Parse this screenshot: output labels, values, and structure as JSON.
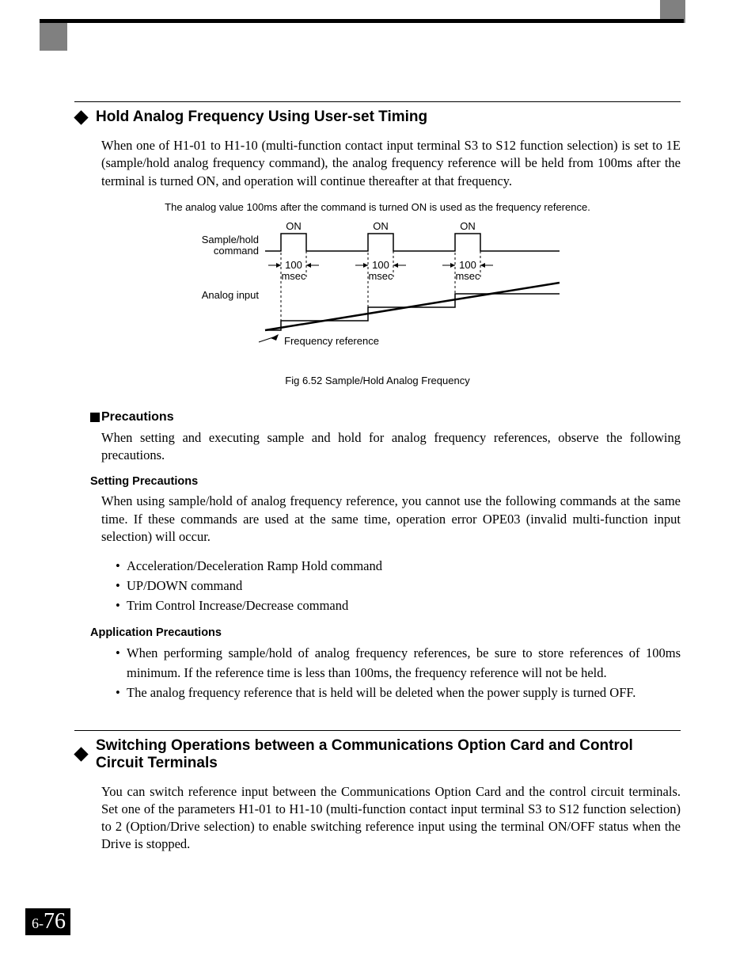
{
  "section1": {
    "title": "Hold Analog Frequency Using User-set Timing",
    "para1": "When one of H1-01 to H1-10 (multi-function contact input terminal S3 to S12 function selection) is set to 1E (sample/hold analog frequency command), the analog frequency reference will be held from 100ms after the terminal is turned ON, and operation will continue thereafter at that frequency.",
    "figure_note": "The analog value 100ms after the command is turned ON is used as the frequency reference.",
    "figure": {
      "labels": {
        "on1": "ON",
        "on2": "ON",
        "on3": "ON",
        "sample_hold_line1": "Sample/hold",
        "sample_hold_line2": "command",
        "ms1_top": "100",
        "ms1_bot": "msec",
        "ms2_top": "100",
        "ms2_bot": "msec",
        "ms3_top": "100",
        "ms3_bot": "msec",
        "analog_input": "Analog input",
        "freq_ref": "Frequency reference"
      }
    },
    "figure_caption": "Fig 6.52  Sample/Hold Analog Frequency",
    "precautions": {
      "title": "Precautions",
      "para": "When setting and executing sample and hold for analog frequency references, observe the following precautions.",
      "setting": {
        "title": "Setting Precautions",
        "para": "When using sample/hold of analog frequency reference, you cannot use the following commands at the same time. If these commands are used at the same time, operation error OPE03 (invalid multi-function input selection) will occur.",
        "items": [
          "Acceleration/Deceleration Ramp Hold command",
          "UP/DOWN command",
          "Trim Control Increase/Decrease command"
        ]
      },
      "application": {
        "title": "Application Precautions",
        "items": [
          "When performing sample/hold of analog frequency references, be sure to store references of 100ms minimum. If the reference time is less than 100ms, the frequency reference will not be held.",
          "The analog frequency reference that is held will be deleted when the power supply is turned OFF."
        ]
      }
    }
  },
  "section2": {
    "title": "Switching Operations between a Communications Option Card and Control Circuit Terminals",
    "para1": "You can switch reference input between the Communications Option Card and the control circuit terminals. Set one of the parameters H1-01 to H1-10 (multi-function contact input terminal S3 to S12 function selection) to 2 (Option/Drive selection) to enable switching reference input using the terminal ON/OFF status when the Drive is stopped."
  },
  "page_number": {
    "prefix": "6-",
    "number": "76"
  }
}
